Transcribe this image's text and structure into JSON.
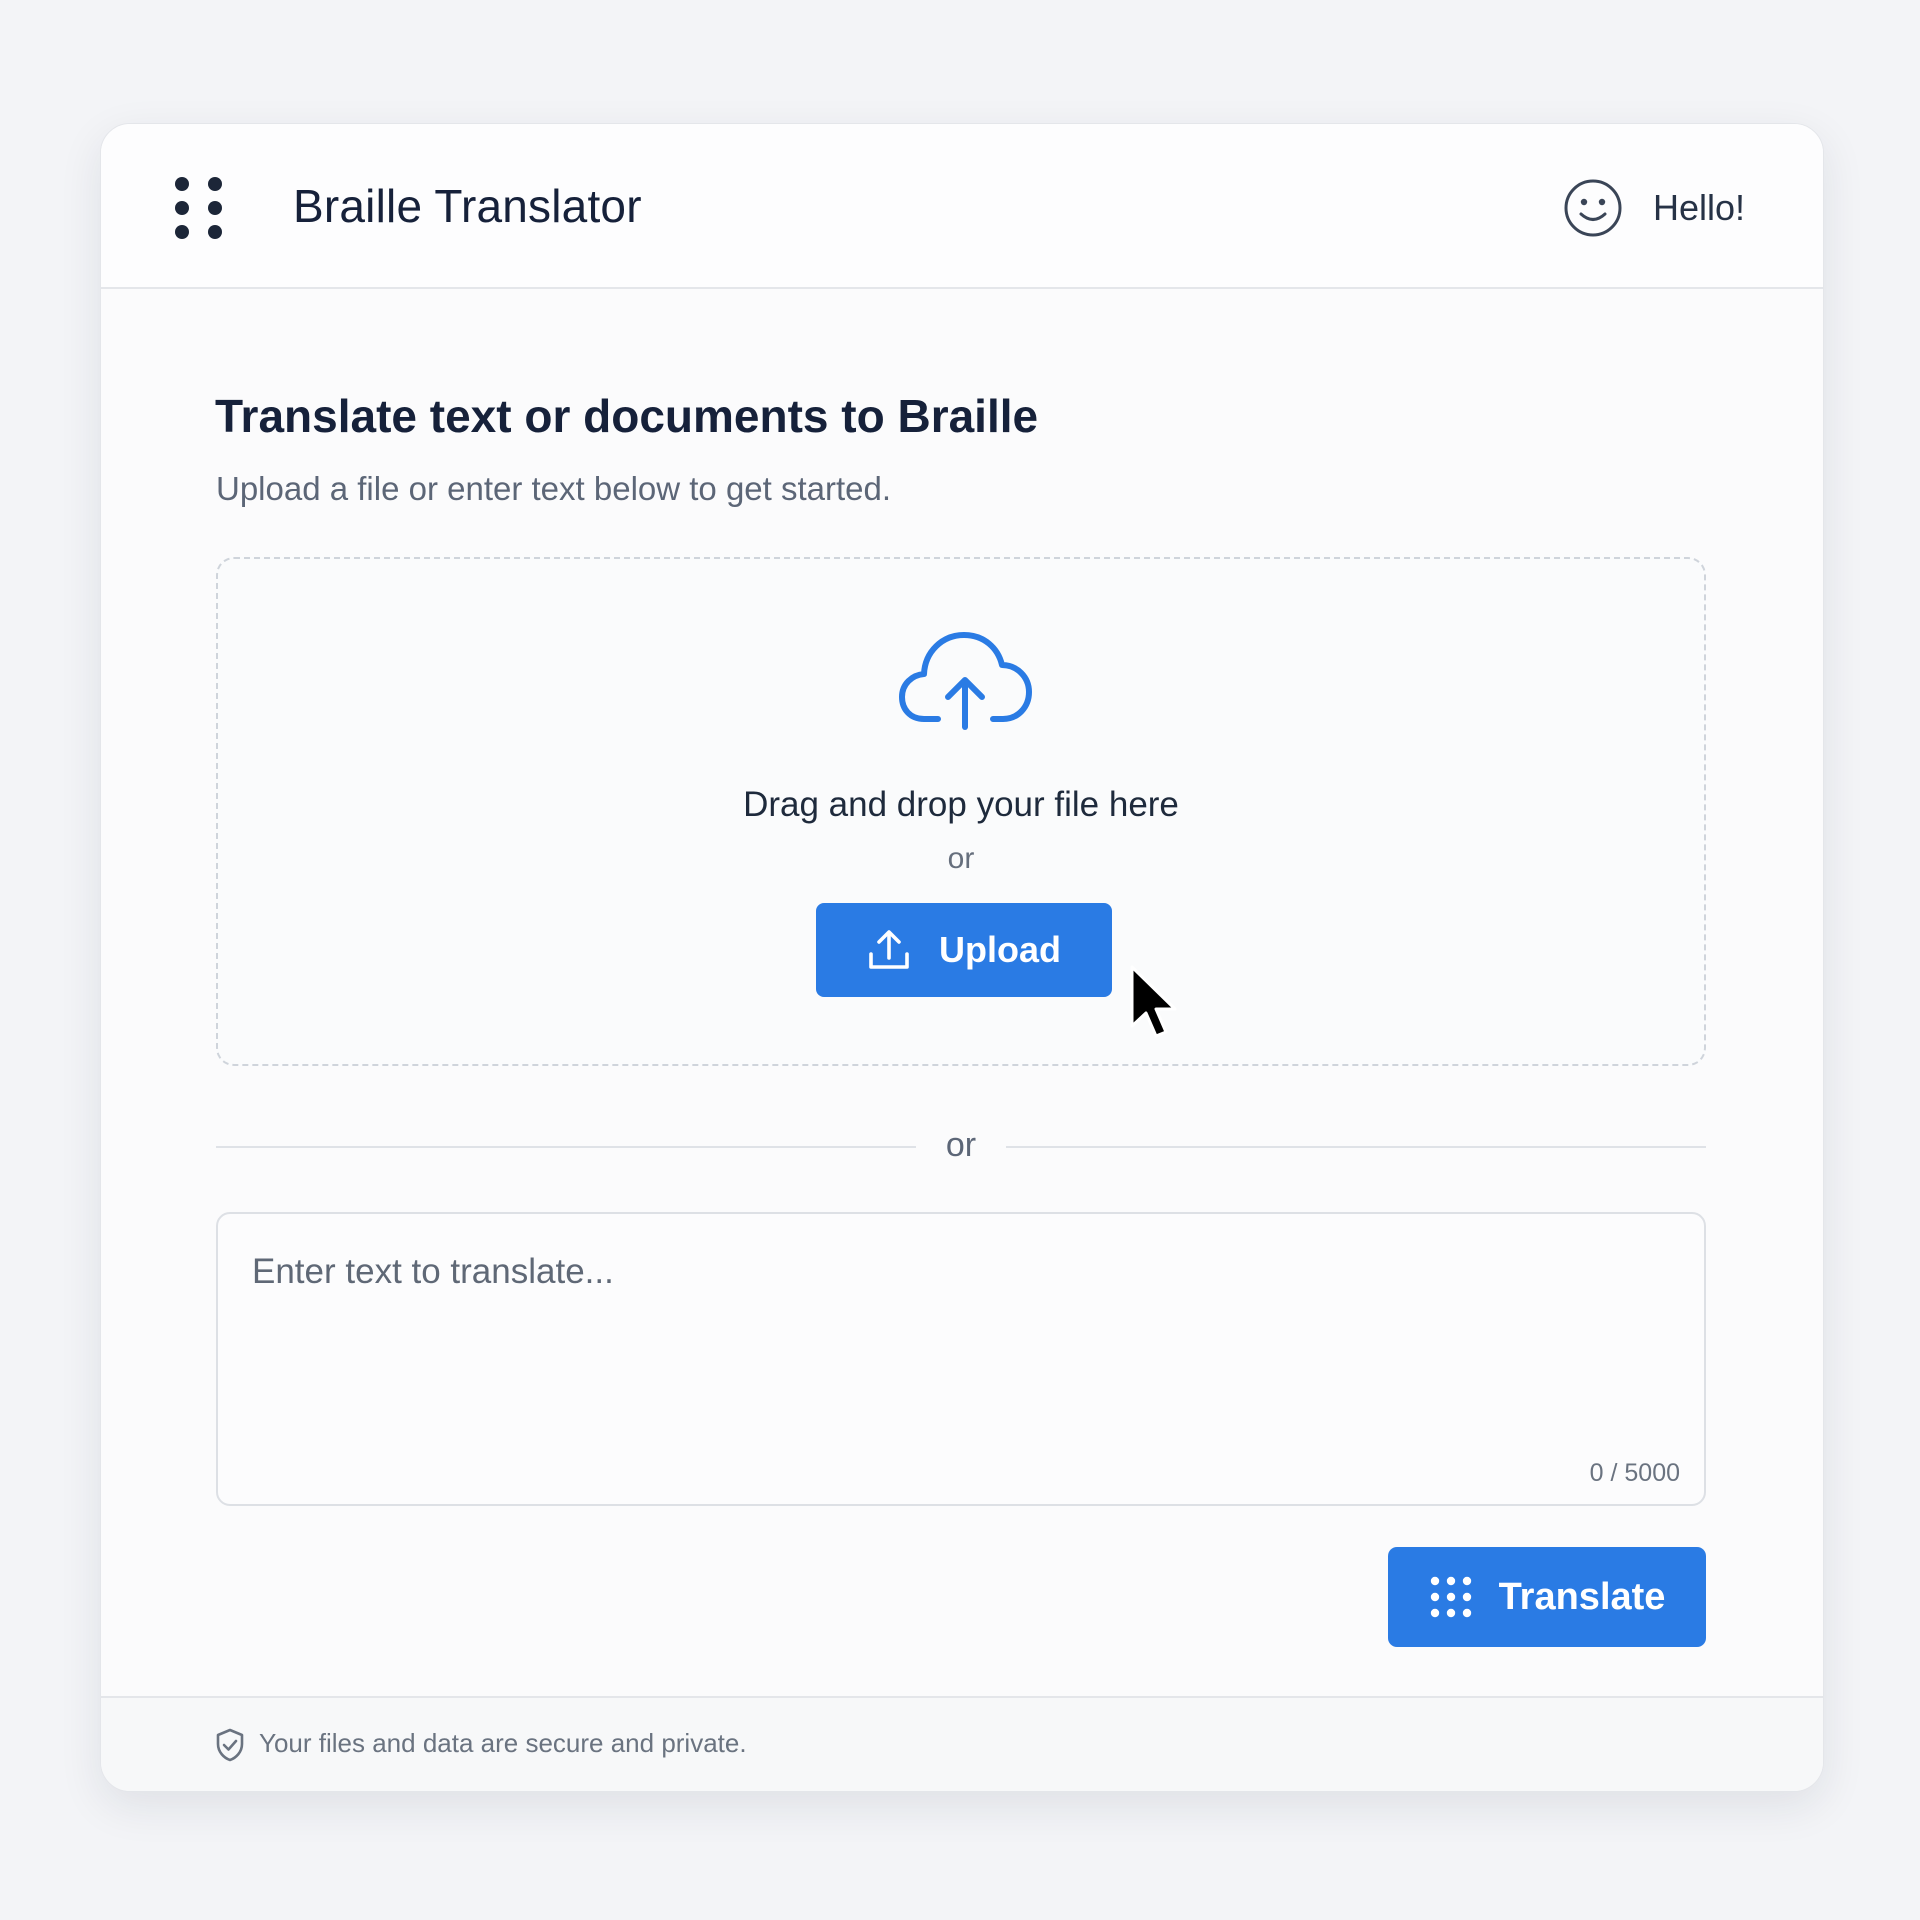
{
  "header": {
    "app_title": "Braille Translator",
    "greeting": "Hello!"
  },
  "main": {
    "title": "Translate text or documents to Braille",
    "subtitle": "Upload a file or enter text below to get started."
  },
  "dropzone": {
    "text": "Drag and drop your file here",
    "or": "or",
    "upload_label": "Upload"
  },
  "divider": {
    "or": "or"
  },
  "text_input": {
    "placeholder": "Enter text to translate...",
    "value": "",
    "char_count": "0 / 5000"
  },
  "actions": {
    "translate_label": "Translate"
  },
  "footer": {
    "security_text": "Your files and data are secure and private."
  },
  "icons": {
    "logo": "braille-dots-icon",
    "avatar": "smiley-icon",
    "upload_area": "cloud-upload-icon",
    "upload_button": "upload-icon",
    "translate_button": "braille-grid-icon",
    "footer": "shield-check-icon"
  },
  "colors": {
    "accent": "#2a7be4",
    "title": "#16213a",
    "muted": "#5c6677",
    "background": "#f3f4f7",
    "card": "#fbfbfc"
  }
}
